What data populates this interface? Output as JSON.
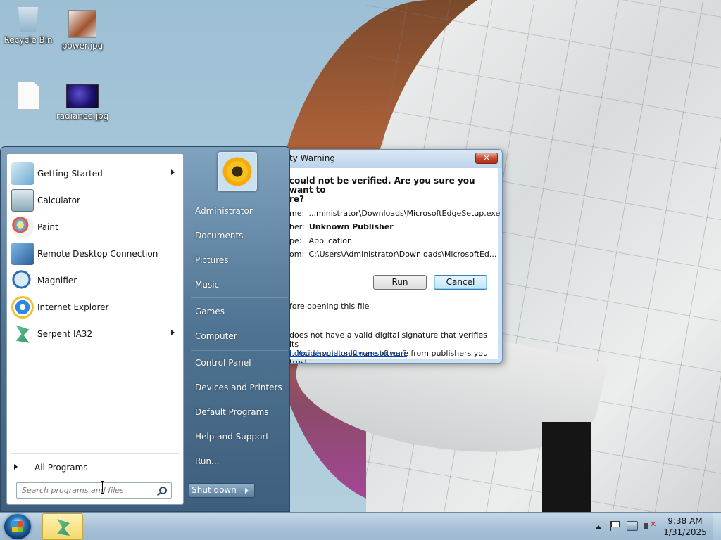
{
  "desktop": {
    "icons": [
      {
        "label": "Recycle Bin",
        "icon": "recycle-bin-icon"
      },
      {
        "label": "power.jpg",
        "icon": "image-file-icon"
      },
      {
        "label": "",
        "icon": "blank-file-icon"
      },
      {
        "label": "radiance.jpg",
        "icon": "image-file-icon"
      }
    ]
  },
  "dialog": {
    "title": "ty Warning",
    "question": "could not be verified.  Are you sure you want to\nre?",
    "rows": [
      {
        "key": "me:",
        "value": "...ministrator\\Downloads\\MicrosoftEdgeSetup.exe"
      },
      {
        "key": "her:",
        "value": "Unknown Publisher"
      },
      {
        "key": "pe:",
        "value": "Application"
      },
      {
        "key": "om:",
        "value": "C:\\Users\\Administrator\\Downloads\\MicrosoftEd..."
      }
    ],
    "run_label": "Run",
    "cancel_label": "Cancel",
    "checkbox_text": "fore opening this file",
    "note": "does not have a valid digital signature that verifies its\nr.  You should only run software from publishers you trust.",
    "link": "I decide what software to run?"
  },
  "startmenu": {
    "programs": [
      {
        "label": "Getting Started",
        "icon": "getting-started-icon",
        "has_submenu": true
      },
      {
        "label": "Calculator",
        "icon": "calculator-icon",
        "has_submenu": false
      },
      {
        "label": "Paint",
        "icon": "paint-icon",
        "has_submenu": false
      },
      {
        "label": "Remote Desktop Connection",
        "icon": "remote-desktop-icon",
        "has_submenu": false
      },
      {
        "label": "Magnifier",
        "icon": "magnifier-icon",
        "has_submenu": false
      },
      {
        "label": "Internet Explorer",
        "icon": "internet-explorer-icon",
        "has_submenu": false
      },
      {
        "label": "Serpent IA32",
        "icon": "serpent-icon",
        "has_submenu": true
      }
    ],
    "all_programs": "All Programs",
    "search_placeholder": "Search programs and files",
    "right_links": [
      "Administrator",
      "Documents",
      "Pictures",
      "Music",
      "Games",
      "Computer",
      "Control Panel",
      "Devices and Printers",
      "Default Programs",
      "Help and Support",
      "Run..."
    ],
    "shutdown_label": "Shut down"
  },
  "taskbar": {
    "time": "9:38 AM",
    "date": "1/31/2025"
  }
}
